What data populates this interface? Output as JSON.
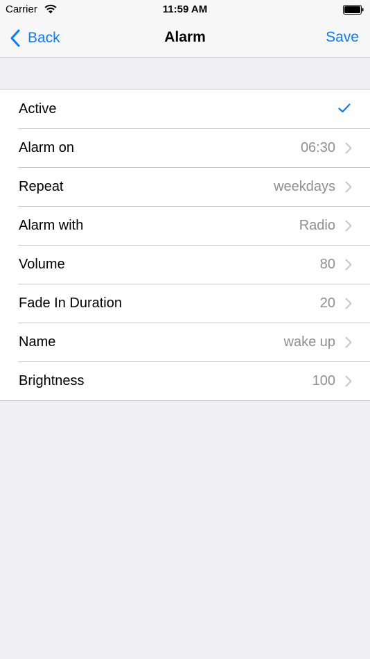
{
  "status_bar": {
    "carrier": "Carrier",
    "time": "11:59 AM",
    "wifi_icon": "wifi-icon",
    "battery_icon": "battery-icon"
  },
  "nav": {
    "back_label": "Back",
    "title": "Alarm",
    "save_label": "Save",
    "accent_color": "#0a7aff"
  },
  "settings": {
    "active": {
      "label": "Active",
      "checked": true,
      "icon": "checkmark-icon"
    },
    "rows": [
      {
        "label": "Alarm on",
        "value": "06:30"
      },
      {
        "label": "Repeat",
        "value": "weekdays"
      },
      {
        "label": "Alarm with",
        "value": "Radio"
      },
      {
        "label": "Volume",
        "value": "80"
      },
      {
        "label": "Fade In Duration",
        "value": "20"
      },
      {
        "label": "Name",
        "value": "wake up"
      },
      {
        "label": "Brightness",
        "value": "100"
      }
    ]
  }
}
